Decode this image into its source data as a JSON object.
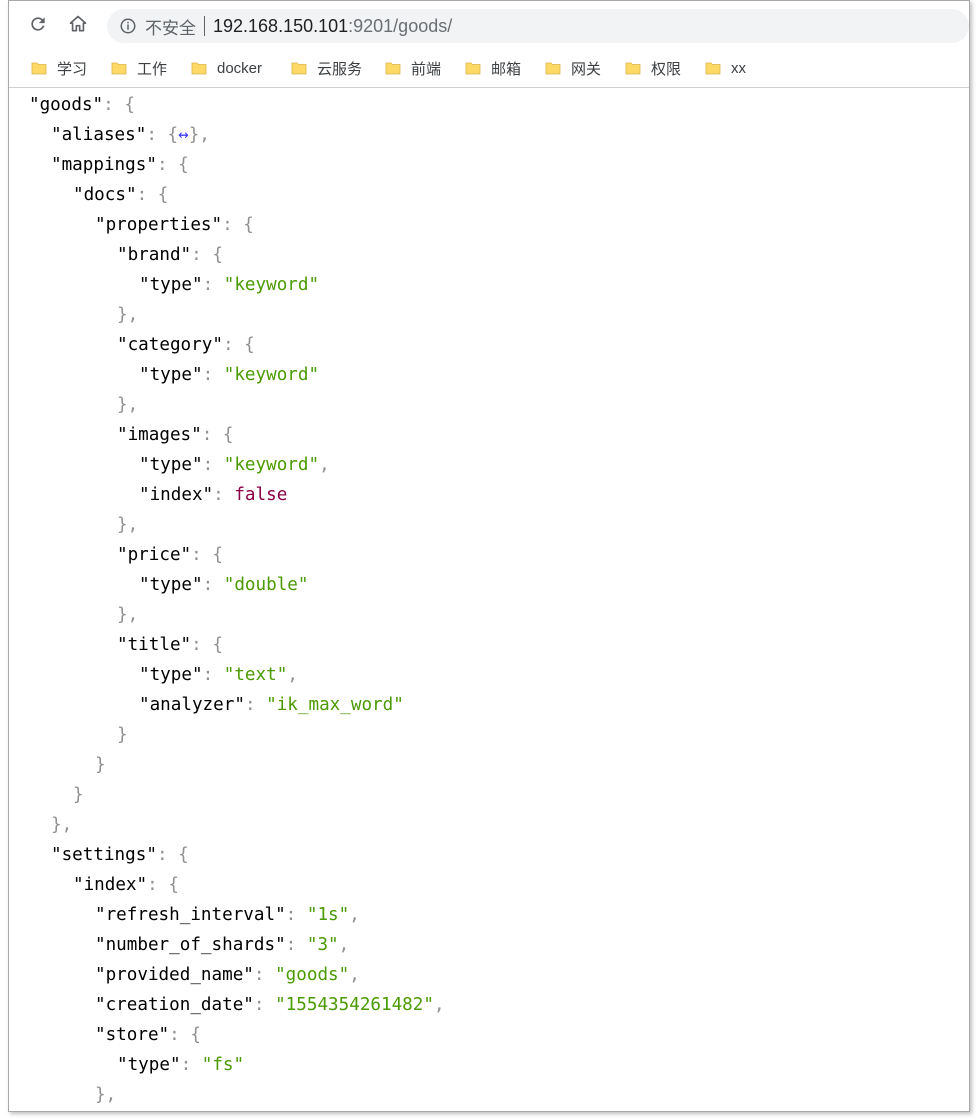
{
  "browser": {
    "insecure_label": "不安全",
    "url_host": "192.168.150.101",
    "url_rest": ":9201/goods/",
    "reload_icon": "reload-icon",
    "home_icon": "home-icon",
    "info_icon": "info-icon"
  },
  "bookmarks": [
    {
      "label": "学习"
    },
    {
      "label": "工作"
    },
    {
      "label": "docker"
    },
    {
      "label": "云服务"
    },
    {
      "label": "前端"
    },
    {
      "label": "邮箱"
    },
    {
      "label": "网关"
    },
    {
      "label": "权限"
    },
    {
      "label": "xx"
    }
  ],
  "json_lines": [
    {
      "indent": 0,
      "parts": [
        [
          "k",
          "\"goods\""
        ],
        [
          "p",
          ": {"
        ]
      ]
    },
    {
      "indent": 1,
      "parts": [
        [
          "k",
          "\"aliases\""
        ],
        [
          "p",
          ": {"
        ],
        [
          "c",
          "↔"
        ],
        [
          "p",
          "},"
        ]
      ]
    },
    {
      "indent": 1,
      "parts": [
        [
          "k",
          "\"mappings\""
        ],
        [
          "p",
          ": {"
        ]
      ]
    },
    {
      "indent": 2,
      "parts": [
        [
          "k",
          "\"docs\""
        ],
        [
          "p",
          ": {"
        ]
      ]
    },
    {
      "indent": 3,
      "parts": [
        [
          "k",
          "\"properties\""
        ],
        [
          "p",
          ": {"
        ]
      ]
    },
    {
      "indent": 4,
      "parts": [
        [
          "k",
          "\"brand\""
        ],
        [
          "p",
          ": {"
        ]
      ]
    },
    {
      "indent": 5,
      "parts": [
        [
          "k",
          "\"type\""
        ],
        [
          "p",
          ": "
        ],
        [
          "s",
          "\"keyword\""
        ]
      ]
    },
    {
      "indent": 4,
      "parts": [
        [
          "p",
          "},"
        ]
      ]
    },
    {
      "indent": 4,
      "parts": [
        [
          "k",
          "\"category\""
        ],
        [
          "p",
          ": {"
        ]
      ]
    },
    {
      "indent": 5,
      "parts": [
        [
          "k",
          "\"type\""
        ],
        [
          "p",
          ": "
        ],
        [
          "s",
          "\"keyword\""
        ]
      ]
    },
    {
      "indent": 4,
      "parts": [
        [
          "p",
          "},"
        ]
      ]
    },
    {
      "indent": 4,
      "parts": [
        [
          "k",
          "\"images\""
        ],
        [
          "p",
          ": {"
        ]
      ]
    },
    {
      "indent": 5,
      "parts": [
        [
          "k",
          "\"type\""
        ],
        [
          "p",
          ": "
        ],
        [
          "s",
          "\"keyword\""
        ],
        [
          "p",
          ","
        ]
      ]
    },
    {
      "indent": 5,
      "parts": [
        [
          "k",
          "\"index\""
        ],
        [
          "p",
          ": "
        ],
        [
          "b",
          "false"
        ]
      ]
    },
    {
      "indent": 4,
      "parts": [
        [
          "p",
          "},"
        ]
      ]
    },
    {
      "indent": 4,
      "parts": [
        [
          "k",
          "\"price\""
        ],
        [
          "p",
          ": {"
        ]
      ]
    },
    {
      "indent": 5,
      "parts": [
        [
          "k",
          "\"type\""
        ],
        [
          "p",
          ": "
        ],
        [
          "s",
          "\"double\""
        ]
      ]
    },
    {
      "indent": 4,
      "parts": [
        [
          "p",
          "},"
        ]
      ]
    },
    {
      "indent": 4,
      "parts": [
        [
          "k",
          "\"title\""
        ],
        [
          "p",
          ": {"
        ]
      ]
    },
    {
      "indent": 5,
      "parts": [
        [
          "k",
          "\"type\""
        ],
        [
          "p",
          ": "
        ],
        [
          "s",
          "\"text\""
        ],
        [
          "p",
          ","
        ]
      ]
    },
    {
      "indent": 5,
      "parts": [
        [
          "k",
          "\"analyzer\""
        ],
        [
          "p",
          ": "
        ],
        [
          "s",
          "\"ik_max_word\""
        ]
      ]
    },
    {
      "indent": 4,
      "parts": [
        [
          "p",
          "}"
        ]
      ]
    },
    {
      "indent": 3,
      "parts": [
        [
          "p",
          "}"
        ]
      ]
    },
    {
      "indent": 2,
      "parts": [
        [
          "p",
          "}"
        ]
      ]
    },
    {
      "indent": 1,
      "parts": [
        [
          "p",
          "},"
        ]
      ]
    },
    {
      "indent": 1,
      "parts": [
        [
          "k",
          "\"settings\""
        ],
        [
          "p",
          ": {"
        ]
      ]
    },
    {
      "indent": 2,
      "parts": [
        [
          "k",
          "\"index\""
        ],
        [
          "p",
          ": {"
        ]
      ]
    },
    {
      "indent": 3,
      "parts": [
        [
          "k",
          "\"refresh_interval\""
        ],
        [
          "p",
          ": "
        ],
        [
          "s",
          "\"1s\""
        ],
        [
          "p",
          ","
        ]
      ]
    },
    {
      "indent": 3,
      "parts": [
        [
          "k",
          "\"number_of_shards\""
        ],
        [
          "p",
          ": "
        ],
        [
          "s",
          "\"3\""
        ],
        [
          "p",
          ","
        ]
      ]
    },
    {
      "indent": 3,
      "parts": [
        [
          "k",
          "\"provided_name\""
        ],
        [
          "p",
          ": "
        ],
        [
          "s",
          "\"goods\""
        ],
        [
          "p",
          ","
        ]
      ]
    },
    {
      "indent": 3,
      "parts": [
        [
          "k",
          "\"creation_date\""
        ],
        [
          "p",
          ": "
        ],
        [
          "s",
          "\"1554354261482\""
        ],
        [
          "p",
          ","
        ]
      ]
    },
    {
      "indent": 3,
      "parts": [
        [
          "k",
          "\"store\""
        ],
        [
          "p",
          ": {"
        ]
      ]
    },
    {
      "indent": 4,
      "parts": [
        [
          "k",
          "\"type\""
        ],
        [
          "p",
          ": "
        ],
        [
          "s",
          "\"fs\""
        ]
      ]
    },
    {
      "indent": 3,
      "parts": [
        [
          "p",
          "},"
        ]
      ]
    }
  ],
  "colors": {
    "key": "#000000",
    "punctuation": "#909090",
    "string": "#4a9a00",
    "boolean": "#8b0047",
    "collapse": "#3b3bff",
    "folder": "#ffd966"
  }
}
